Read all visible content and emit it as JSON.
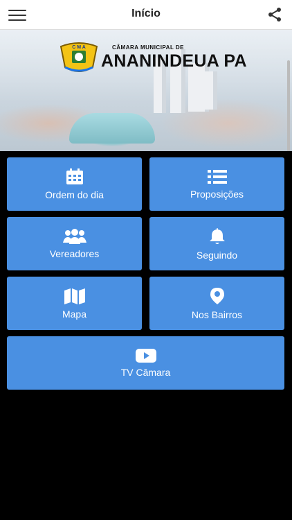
{
  "header": {
    "title": "Início",
    "menu_icon": "hamburger-menu-icon",
    "share_icon": "share-icon"
  },
  "banner": {
    "logo_letters": "C M A",
    "logo_top_text": "CÂMARA MUNICIPAL DE",
    "logo_main_text": "ANANINDEUA PA"
  },
  "menu": [
    {
      "label": "Ordem do dia",
      "icon": "calendar-icon"
    },
    {
      "label": "Proposições",
      "icon": "list-icon"
    },
    {
      "label": "Vereadores",
      "icon": "users-icon"
    },
    {
      "label": "Seguindo",
      "icon": "bell-icon"
    },
    {
      "label": "Mapa",
      "icon": "map-icon"
    },
    {
      "label": "Nos Bairros",
      "icon": "map-marker-icon"
    },
    {
      "label": "TV Câmara",
      "icon": "youtube-icon"
    }
  ],
  "colors": {
    "tile_bg": "#4a90e2",
    "background": "#000000",
    "header_bg": "#ffffff"
  }
}
